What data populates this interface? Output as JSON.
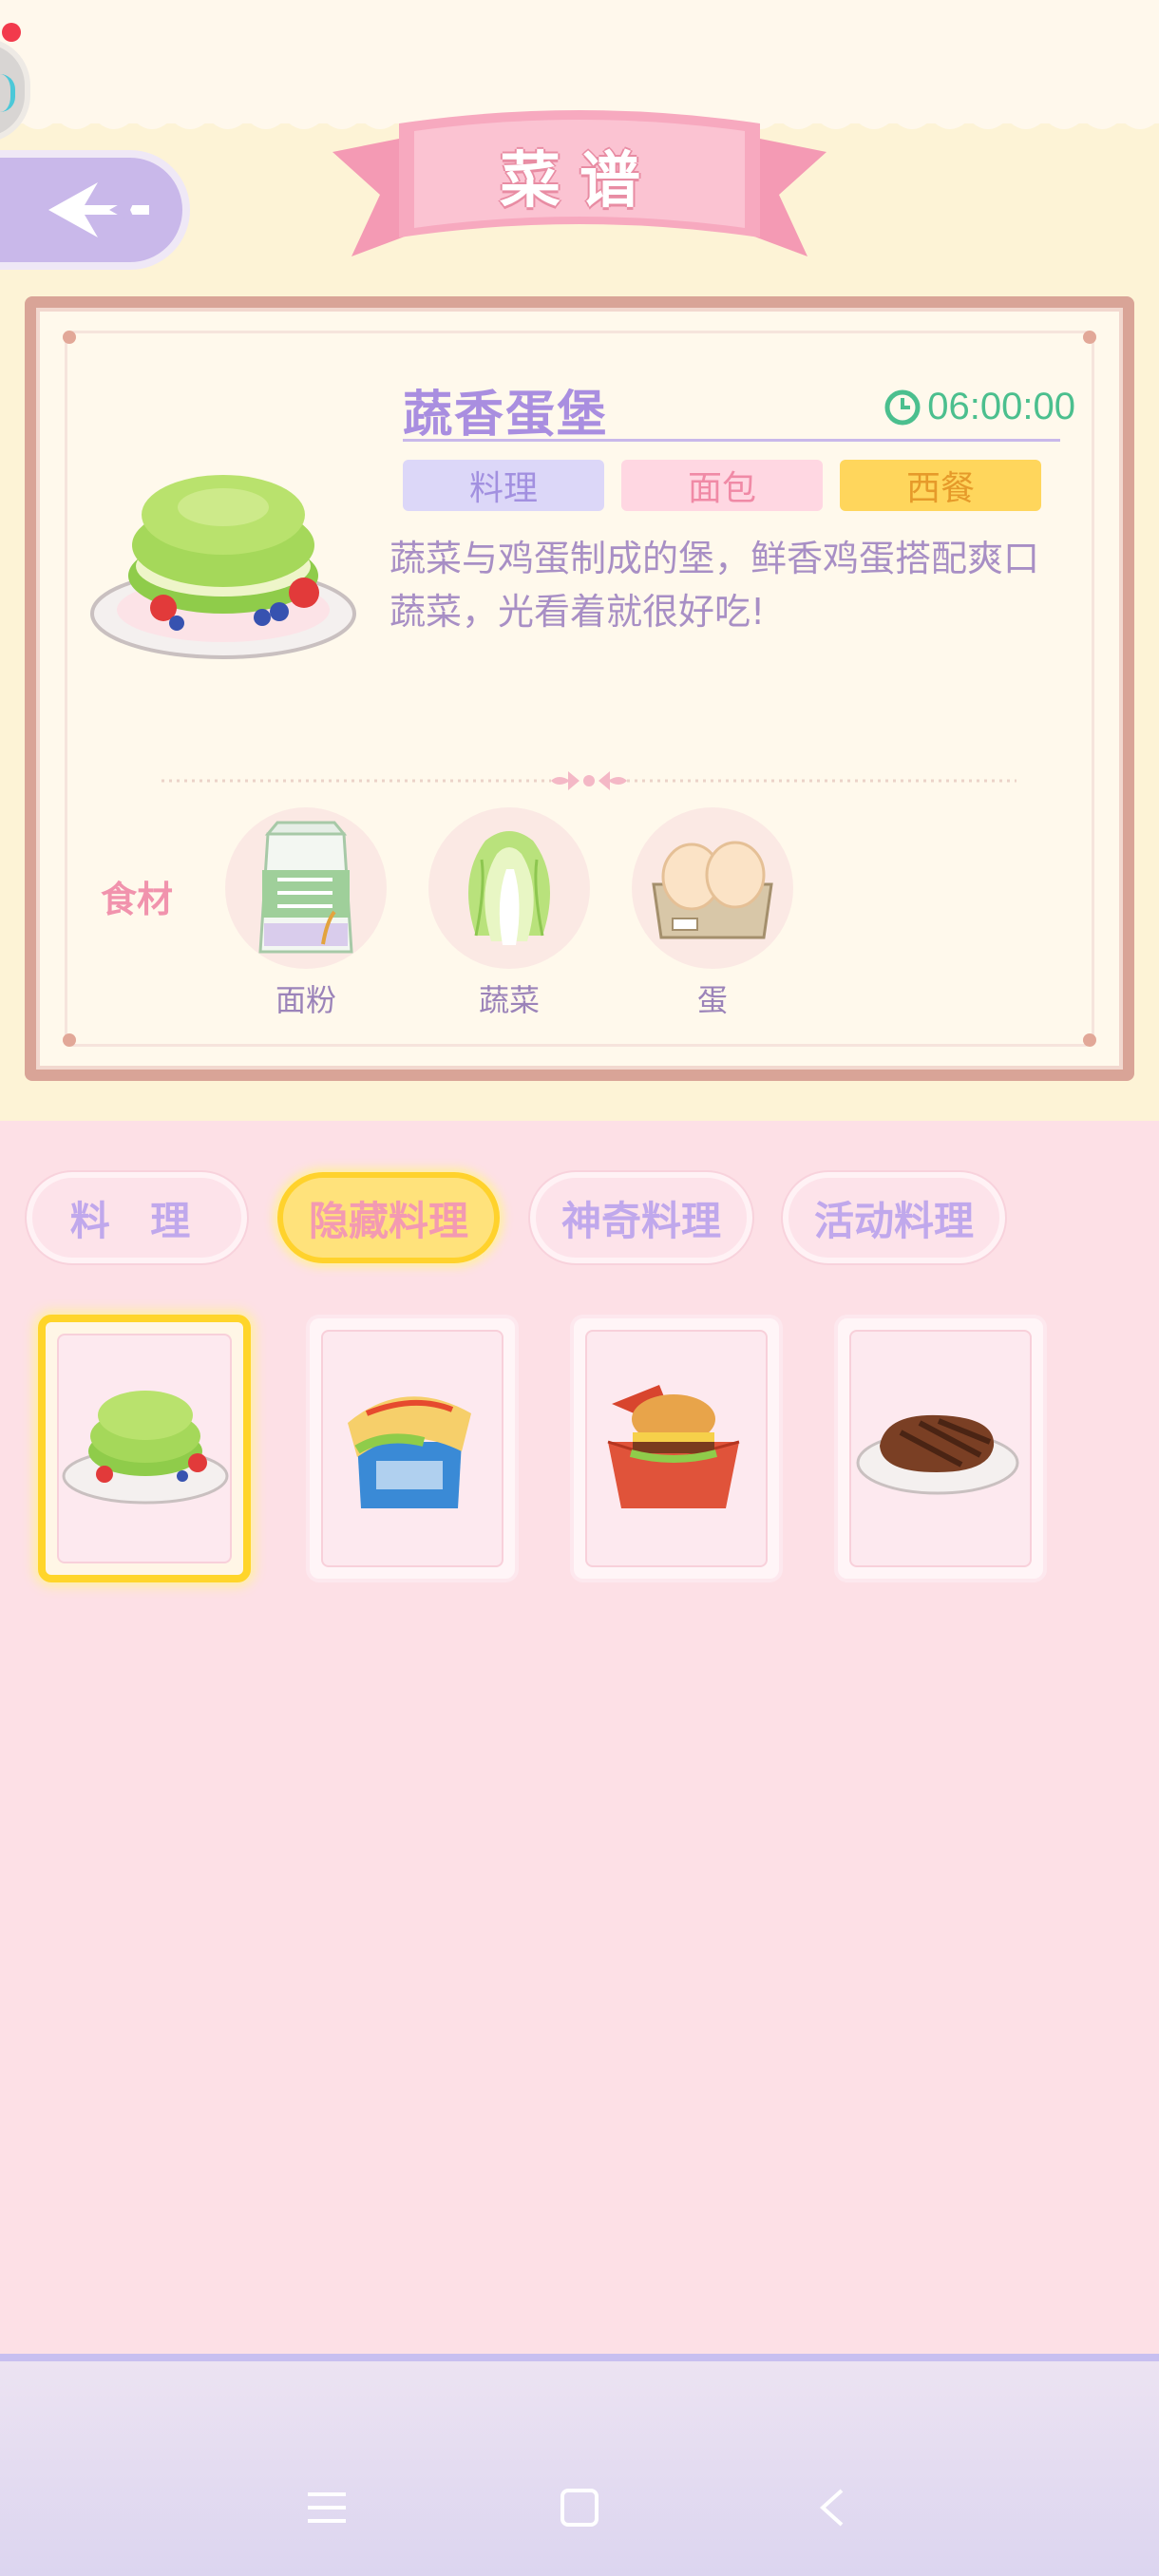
{
  "header": {
    "title": "菜谱"
  },
  "dish": {
    "name": "蔬香蛋堡",
    "timer": "06:00:00",
    "tags": [
      "料理",
      "面包",
      "西餐"
    ],
    "description": "蔬菜与鸡蛋制成的堡，鲜香鸡蛋搭配爽口蔬菜，光看着就很好吃!"
  },
  "ingredients": {
    "label": "食材",
    "items": [
      {
        "name": "面粉",
        "icon": "flour-bag-icon"
      },
      {
        "name": "蔬菜",
        "icon": "cabbage-icon"
      },
      {
        "name": "蛋",
        "icon": "egg-carton-icon"
      }
    ]
  },
  "tabs": [
    {
      "label": "料 理",
      "selected": false
    },
    {
      "label": "隐藏料理",
      "selected": true
    },
    {
      "label": "神奇料理",
      "selected": false
    },
    {
      "label": "活动料理",
      "selected": false
    }
  ],
  "recipes": [
    {
      "icon": "veggie-egg-burger-icon",
      "selected": true
    },
    {
      "icon": "omelette-sandwich-box-icon",
      "selected": false
    },
    {
      "icon": "burger-box-icon",
      "selected": false
    },
    {
      "icon": "steak-plate-icon",
      "selected": false
    }
  ],
  "colors": {
    "cream": "#fdf3d6",
    "pink": "#fde0e6",
    "purple_text": "#a98ee0",
    "timer_green": "#4bbf8e",
    "selected_yellow": "#ffd52a"
  }
}
